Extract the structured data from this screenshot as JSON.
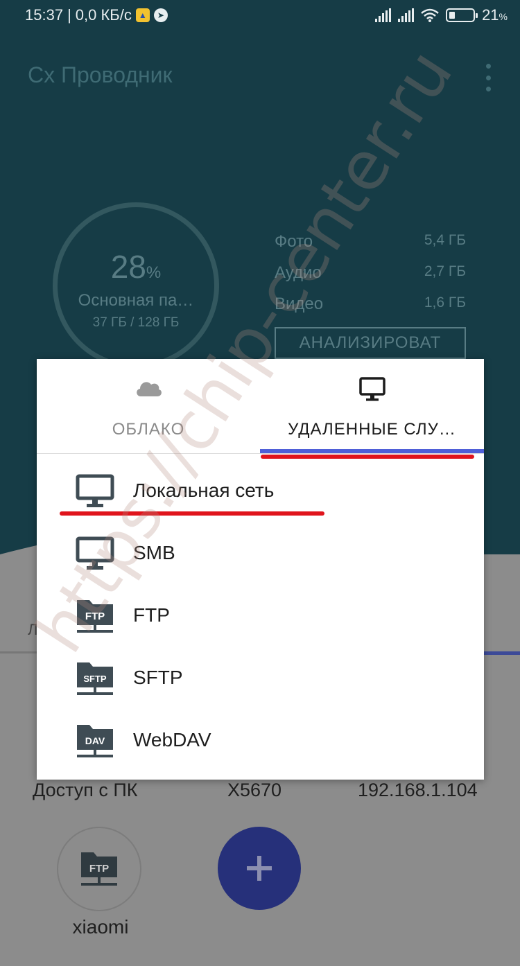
{
  "status_bar": {
    "time": "15:37",
    "separator": "|",
    "speed": "0,0 КБ/с",
    "battery": "21",
    "battery_unit": "%"
  },
  "app": {
    "title": "Cx Проводник"
  },
  "storage": {
    "percent": "28",
    "percent_sign": "%",
    "name": "Основная па…",
    "size": "37 ГБ / 128 ГБ",
    "fill_fraction": 0.28
  },
  "categories": [
    {
      "label": "Фото",
      "value": "5,4 ГБ"
    },
    {
      "label": "Аудио",
      "value": "2,7 ГБ"
    },
    {
      "label": "Видео",
      "value": "1,6 ГБ"
    }
  ],
  "analyze_label": "АНАЛИЗИРОВАТ",
  "dialog": {
    "tabs": [
      {
        "label": "ОБЛАКО",
        "icon": "cloud-icon",
        "selected": false
      },
      {
        "label": "УДАЛЕННЫЕ СЛУ…",
        "icon": "monitor-icon",
        "selected": true
      }
    ],
    "items": [
      {
        "label": "Локальная сеть",
        "icon": "monitor-icon"
      },
      {
        "label": "SMB",
        "icon": "monitor-icon"
      },
      {
        "label": "FTP",
        "icon": "ftp-folder-icon",
        "badge": "FTP"
      },
      {
        "label": "SFTP",
        "icon": "sftp-folder-icon",
        "badge": "SFTP"
      },
      {
        "label": "WebDAV",
        "icon": "webdav-folder-icon",
        "badge": "DAV"
      }
    ]
  },
  "background": {
    "partial_tab": "Л",
    "remote_access": {
      "label": "Доступ с ПК",
      "device": "X5670",
      "ip": "192.168.1.104"
    },
    "favorite": {
      "label": "xiaomi",
      "badge": "FTP",
      "icon": "ftp-folder-icon"
    },
    "fab_icon": "plus-icon"
  },
  "watermark": "https://chip-center.ru",
  "colors": {
    "header": "#163c46",
    "accent": "#4f5fd8",
    "fab": "#26307a",
    "annotation": "#e0141c",
    "icon": "#3f4c54"
  }
}
